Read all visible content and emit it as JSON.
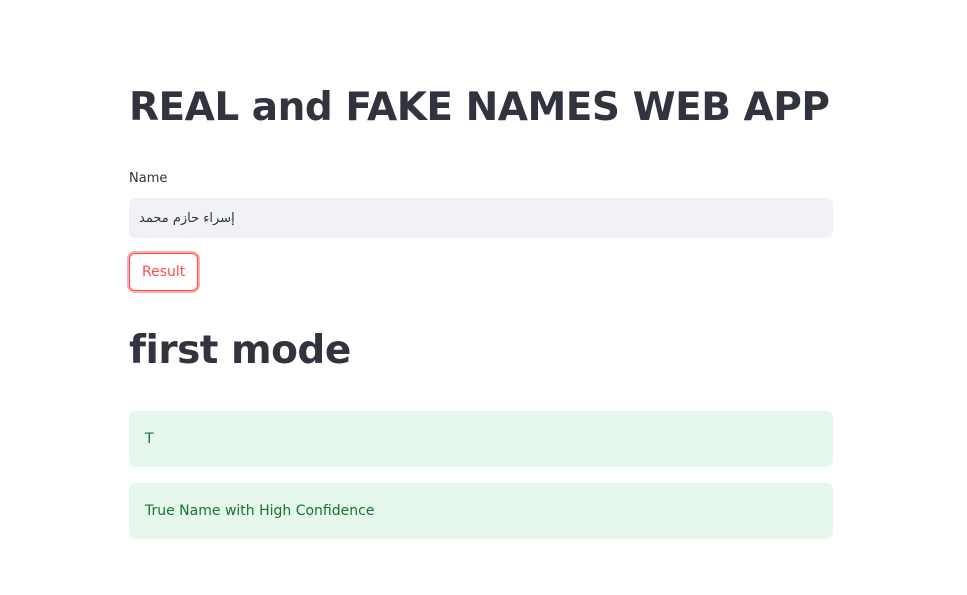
{
  "page": {
    "title": "REAL and FAKE NAMES WEB APP"
  },
  "form": {
    "name_label": "Name",
    "name_value": "إسراء حازم محمد",
    "submit_label": "Result"
  },
  "results": {
    "heading": "first mode",
    "messages": [
      "T",
      "True Name with High Confidence"
    ]
  },
  "colors": {
    "accent": "#ff4b4b",
    "success_bg": "#e6f7ec",
    "success_text": "#177233",
    "input_bg": "#f0f2f6",
    "text": "#31333f"
  }
}
